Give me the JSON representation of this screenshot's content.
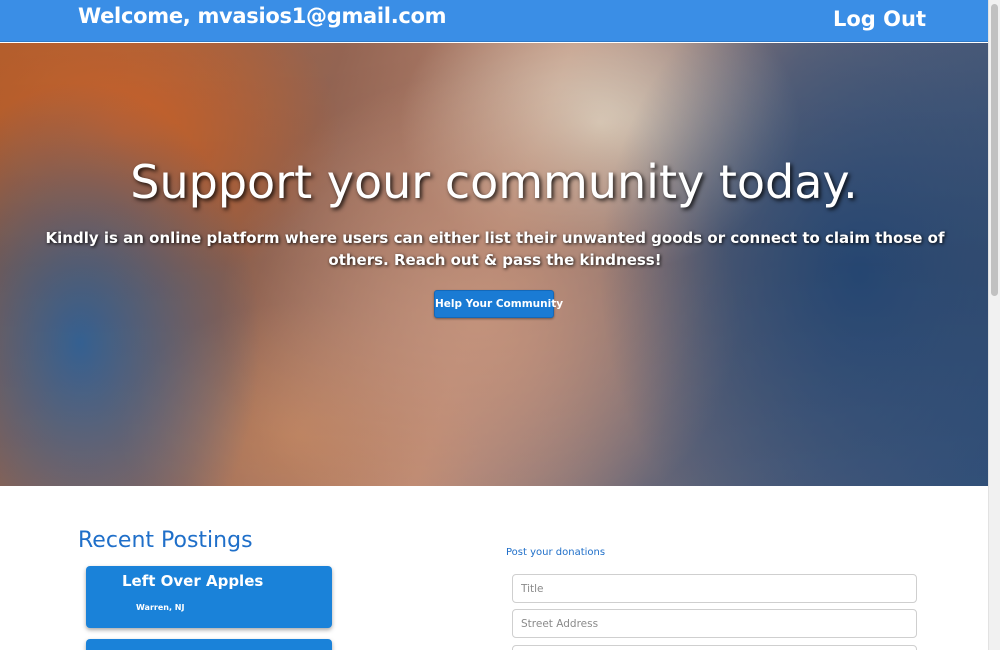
{
  "header": {
    "welcome_text": "Welcome, mvasios1@gmail.com",
    "logout_label": "Log Out"
  },
  "hero": {
    "title": "Support your community today.",
    "description": "Kindly is an online platform where users can either list their unwanted goods or connect to claim those of others. Reach out & pass the kindness!",
    "button_label": "Help Your Community"
  },
  "recent_postings": {
    "heading": "Recent Postings",
    "items": [
      {
        "title": "Left Over Apples",
        "location": "Warren, NJ"
      },
      {
        "title": "",
        "location": ""
      }
    ]
  },
  "donation_form": {
    "heading": "Post your donations",
    "fields": [
      {
        "placeholder": "Title",
        "value": ""
      },
      {
        "placeholder": "Street Address",
        "value": ""
      },
      {
        "placeholder": "",
        "value": ""
      }
    ]
  },
  "colors": {
    "navbar": "#3a8ee6",
    "accent_blue": "#1a82d9",
    "heading_blue": "#1f6fc9"
  }
}
